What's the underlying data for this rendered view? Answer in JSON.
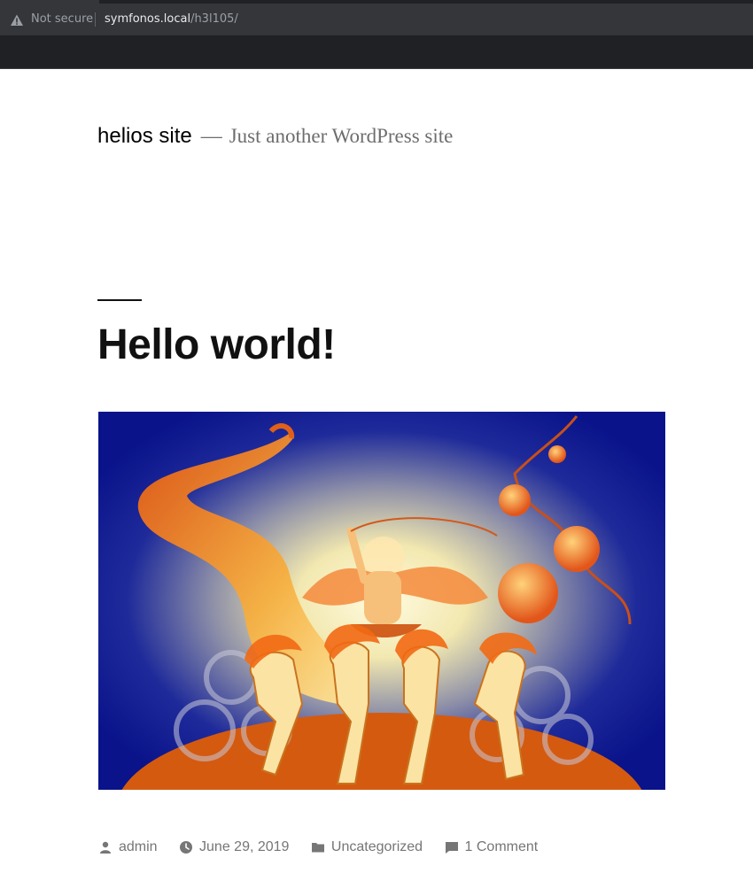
{
  "browser": {
    "security_label": "Not secure",
    "url_host": "symfonos.local",
    "url_path": "/h3l105/"
  },
  "site": {
    "title": "helios site",
    "dash": "—",
    "description": "Just another WordPress site"
  },
  "post": {
    "title": "Hello world!",
    "featured_image_icon": "helios-chariot-illustration",
    "meta": {
      "author": "admin",
      "date": "June 29, 2019",
      "category": "Uncategorized",
      "comments": "1 Comment"
    }
  },
  "colors": {
    "browser_bg": "#202124",
    "omnibox_bg": "#35363a",
    "meta_text": "#767676",
    "title_text": "#111111"
  }
}
